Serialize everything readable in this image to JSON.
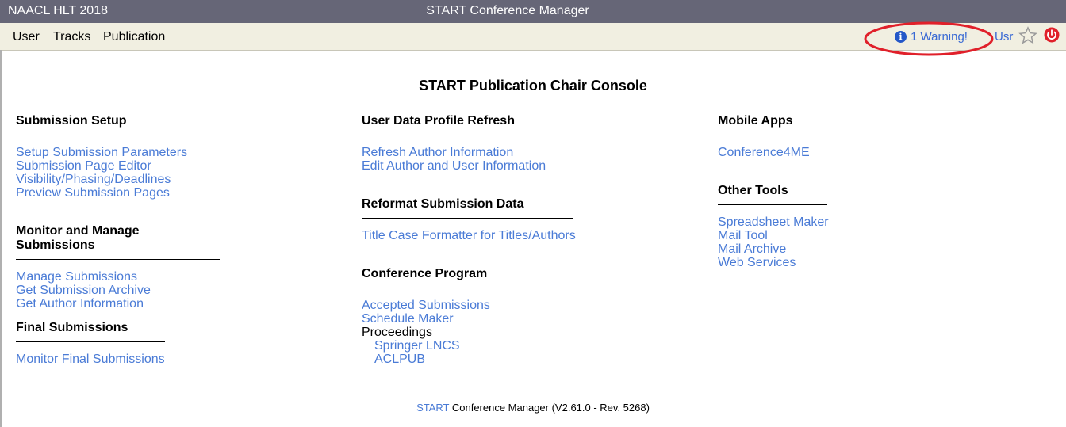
{
  "titlebar": {
    "conference": "NAACL HLT 2018",
    "app_title": "START Conference Manager"
  },
  "menubar": {
    "items": [
      "User",
      "Tracks",
      "Publication"
    ],
    "warning": "1 Warning!",
    "user_short": "Usr"
  },
  "page_title": "START Publication Chair Console",
  "sections": {
    "submission_setup": {
      "title": "Submission Setup",
      "links": [
        "Setup Submission Parameters",
        "Submission Page Editor",
        "Visibility/Phasing/Deadlines",
        "Preview Submission Pages"
      ]
    },
    "monitor_manage": {
      "title": "Monitor and Manage Submissions",
      "links": [
        "Manage Submissions",
        "Get Submission Archive",
        "Get Author Information"
      ]
    },
    "final_submissions": {
      "title": "Final Submissions",
      "links": [
        "Monitor Final Submissions"
      ]
    },
    "user_data_refresh": {
      "title": "User Data Profile Refresh",
      "links": [
        "Refresh Author Information",
        "Edit Author and User Information"
      ]
    },
    "reformat": {
      "title": "Reformat Submission Data",
      "links": [
        "Title Case Formatter for Titles/Authors"
      ]
    },
    "conference_program": {
      "title": "Conference Program",
      "links": [
        "Accepted Submissions",
        "Schedule Maker"
      ],
      "proceedings_label": "Proceedings",
      "proceedings_links": [
        "Springer LNCS",
        "ACLPUB"
      ]
    },
    "mobile_apps": {
      "title": "Mobile Apps",
      "links": [
        "Conference4ME"
      ]
    },
    "other_tools": {
      "title": "Other Tools",
      "links": [
        "Spreadsheet Maker",
        "Mail Tool",
        "Mail Archive",
        "Web Services"
      ]
    }
  },
  "footer": {
    "link": "START",
    "text": " Conference Manager (V2.61.0 - Rev. 5268)"
  },
  "colors": {
    "titlebar_bg": "#666677",
    "menubar_bg": "#f1efe1",
    "link": "#4a7bd6",
    "highlight": "#e0202a"
  },
  "icons": {
    "info": "info-icon",
    "star": "star-icon",
    "power": "power-icon"
  }
}
